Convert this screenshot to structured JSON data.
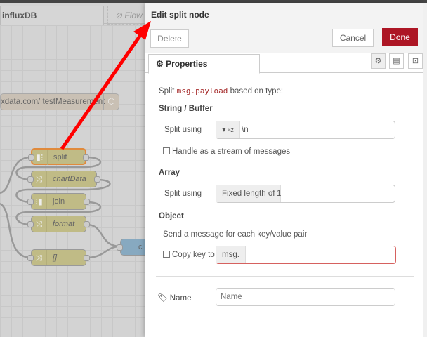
{
  "workspace": {
    "tabs": [
      {
        "label": "influxDB"
      },
      {
        "label": "Flow"
      }
    ],
    "comment_node": "xdata.com/ testMeasurement",
    "nodes": [
      {
        "label": "split",
        "icon": "split-icon"
      },
      {
        "label": "chartData",
        "icon": "change-icon"
      },
      {
        "label": "join",
        "icon": "join-icon"
      },
      {
        "label": "format",
        "icon": "change-icon"
      },
      {
        "label": "[]",
        "icon": "change-icon"
      }
    ],
    "output_node": "c"
  },
  "dialog": {
    "title": "Edit split node",
    "delete_label": "Delete",
    "cancel_label": "Cancel",
    "done_label": "Done",
    "properties_tab": "Properties",
    "intro_prefix": "Split ",
    "intro_code": "msg.payload",
    "intro_suffix": " based on type:",
    "string_heading": "String / Buffer",
    "split_using_label": "Split using",
    "string_type_icon": "a z",
    "string_value": "\\n",
    "stream_label": "Handle as a stream of messages",
    "stream_checked": false,
    "array_heading": "Array",
    "array_type": "Fixed length of",
    "array_value": "1",
    "object_heading": "Object",
    "object_desc": "Send a message for each key/value pair",
    "copy_key_label": "Copy key to",
    "copy_key_checked": false,
    "copy_key_prefix": "msg.",
    "copy_key_value": "",
    "name_label": "Name",
    "name_placeholder": "Name",
    "colors": {
      "done": "#ad1625",
      "annotation_arrow": "#ff0000",
      "code": "#a52a2a"
    }
  }
}
